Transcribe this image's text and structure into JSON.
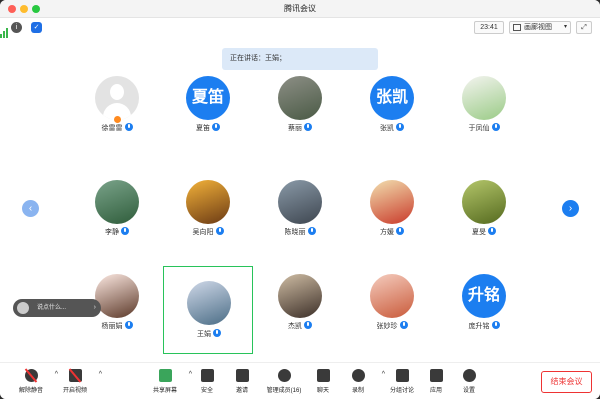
{
  "window": {
    "title": "腾讯会议"
  },
  "status": {
    "timer": "23:41",
    "view_label": "画廊视图"
  },
  "banner": {
    "speaking": "正在讲话：王娟；"
  },
  "participants": [
    {
      "name": "徐雷雷",
      "avatar": "default"
    },
    {
      "name": "夏笛",
      "avatar": "text",
      "avatar_text": "夏笛"
    },
    {
      "name": "蔡丽",
      "avatar": "photo",
      "c1": "#8d8f86",
      "c2": "#4a5a45"
    },
    {
      "name": "张凯",
      "avatar": "text",
      "avatar_text": "张凯"
    },
    {
      "name": "于凤仙",
      "avatar": "photo",
      "c1": "#f4f4f0",
      "c2": "#9acb86"
    },
    {
      "name": "李静",
      "avatar": "photo",
      "c1": "#7aa38a",
      "c2": "#2f5d3b"
    },
    {
      "name": "吴向阳",
      "avatar": "photo",
      "c1": "#f3b23a",
      "c2": "#6b3a14"
    },
    {
      "name": "陈晓丽",
      "avatar": "photo",
      "c1": "#8a9aa8",
      "c2": "#3e4650"
    },
    {
      "name": "方媛",
      "avatar": "photo",
      "c1": "#f2e0b0",
      "c2": "#c93a2a"
    },
    {
      "name": "夏旻",
      "avatar": "photo",
      "c1": "#b4c66a",
      "c2": "#556a1f"
    },
    {
      "name": "杨丽娟",
      "avatar": "photo",
      "c1": "#fde9e2",
      "c2": "#5b3828"
    },
    {
      "name": "王娟",
      "avatar": "photo",
      "c1": "#cfd8e8",
      "c2": "#4b6d86"
    },
    {
      "name": "杰凯",
      "avatar": "photo",
      "c1": "#cfbda4",
      "c2": "#3c2f28"
    },
    {
      "name": "张妙珍",
      "avatar": "photo",
      "c1": "#f5cdbf",
      "c2": "#c95a3a"
    },
    {
      "name": "庞升铭",
      "avatar": "text",
      "avatar_text": "升铭"
    }
  ],
  "chat": {
    "placeholder": "说点什么..."
  },
  "toolbar": {
    "unmute": "解除静音",
    "video": "开启视频",
    "share": "共享屏幕",
    "security": "安全",
    "invite": "邀请",
    "members": "管理成员(16)",
    "chat": "聊天",
    "record": "录制",
    "breakout": "分组讨论",
    "apps": "应用",
    "settings": "设置",
    "end": "结束会议"
  },
  "colors": {
    "accent": "#1c7ef0",
    "selected": "#28c35a",
    "end": "#e33"
  }
}
